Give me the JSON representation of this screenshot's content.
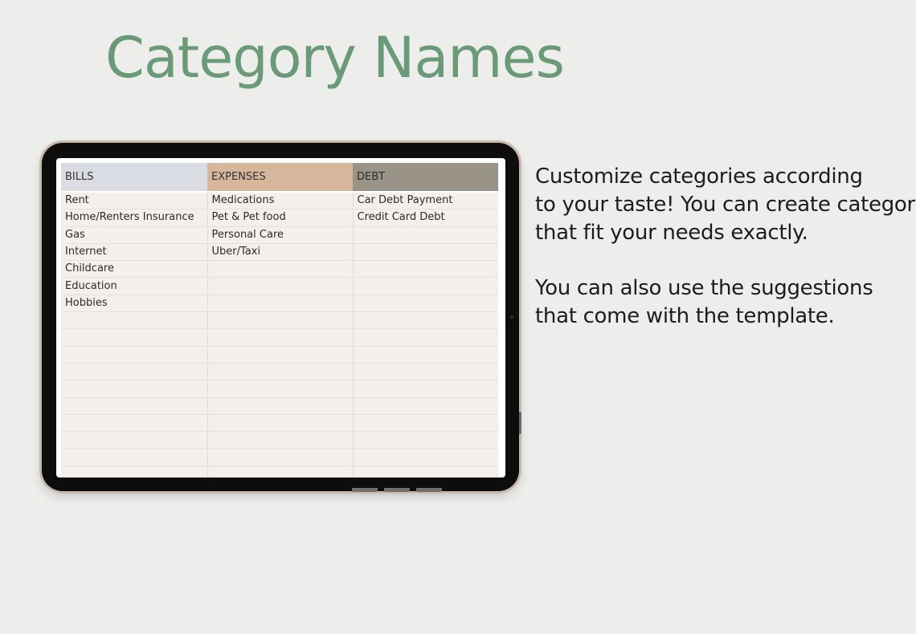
{
  "page": {
    "title": "Category Names",
    "title_color": "#6a9a78",
    "background_color": "#ededec"
  },
  "sheet": {
    "columns": [
      {
        "label": "BILLS",
        "color": "#d9dde3"
      },
      {
        "label": "EXPENSES",
        "color": "#d6b79c"
      },
      {
        "label": "DEBT",
        "color": "#9a9488"
      }
    ],
    "rows": [
      [
        "Rent",
        "Medications",
        "Car Debt Payment"
      ],
      [
        "Home/Renters Insurance",
        "Pet & Pet food",
        "Credit Card Debt"
      ],
      [
        "Gas",
        "Personal Care",
        ""
      ],
      [
        "Internet",
        "Uber/Taxi",
        ""
      ],
      [
        "Childcare",
        "",
        ""
      ],
      [
        "Education",
        "",
        ""
      ],
      [
        "Hobbies",
        "",
        ""
      ],
      [
        "",
        "",
        ""
      ],
      [
        "",
        "",
        ""
      ],
      [
        "",
        "",
        ""
      ],
      [
        "",
        "",
        ""
      ],
      [
        "",
        "",
        ""
      ],
      [
        "",
        "",
        ""
      ],
      [
        "",
        "",
        ""
      ],
      [
        "",
        "",
        ""
      ],
      [
        "",
        "",
        ""
      ],
      [
        "",
        "",
        ""
      ]
    ]
  },
  "description": {
    "paragraph1": [
      "Customize categories according",
      "to your taste! You can create categories",
      "that fit your needs exactly."
    ],
    "paragraph2": [
      "You can also use the suggestions",
      "that come with the template."
    ]
  }
}
